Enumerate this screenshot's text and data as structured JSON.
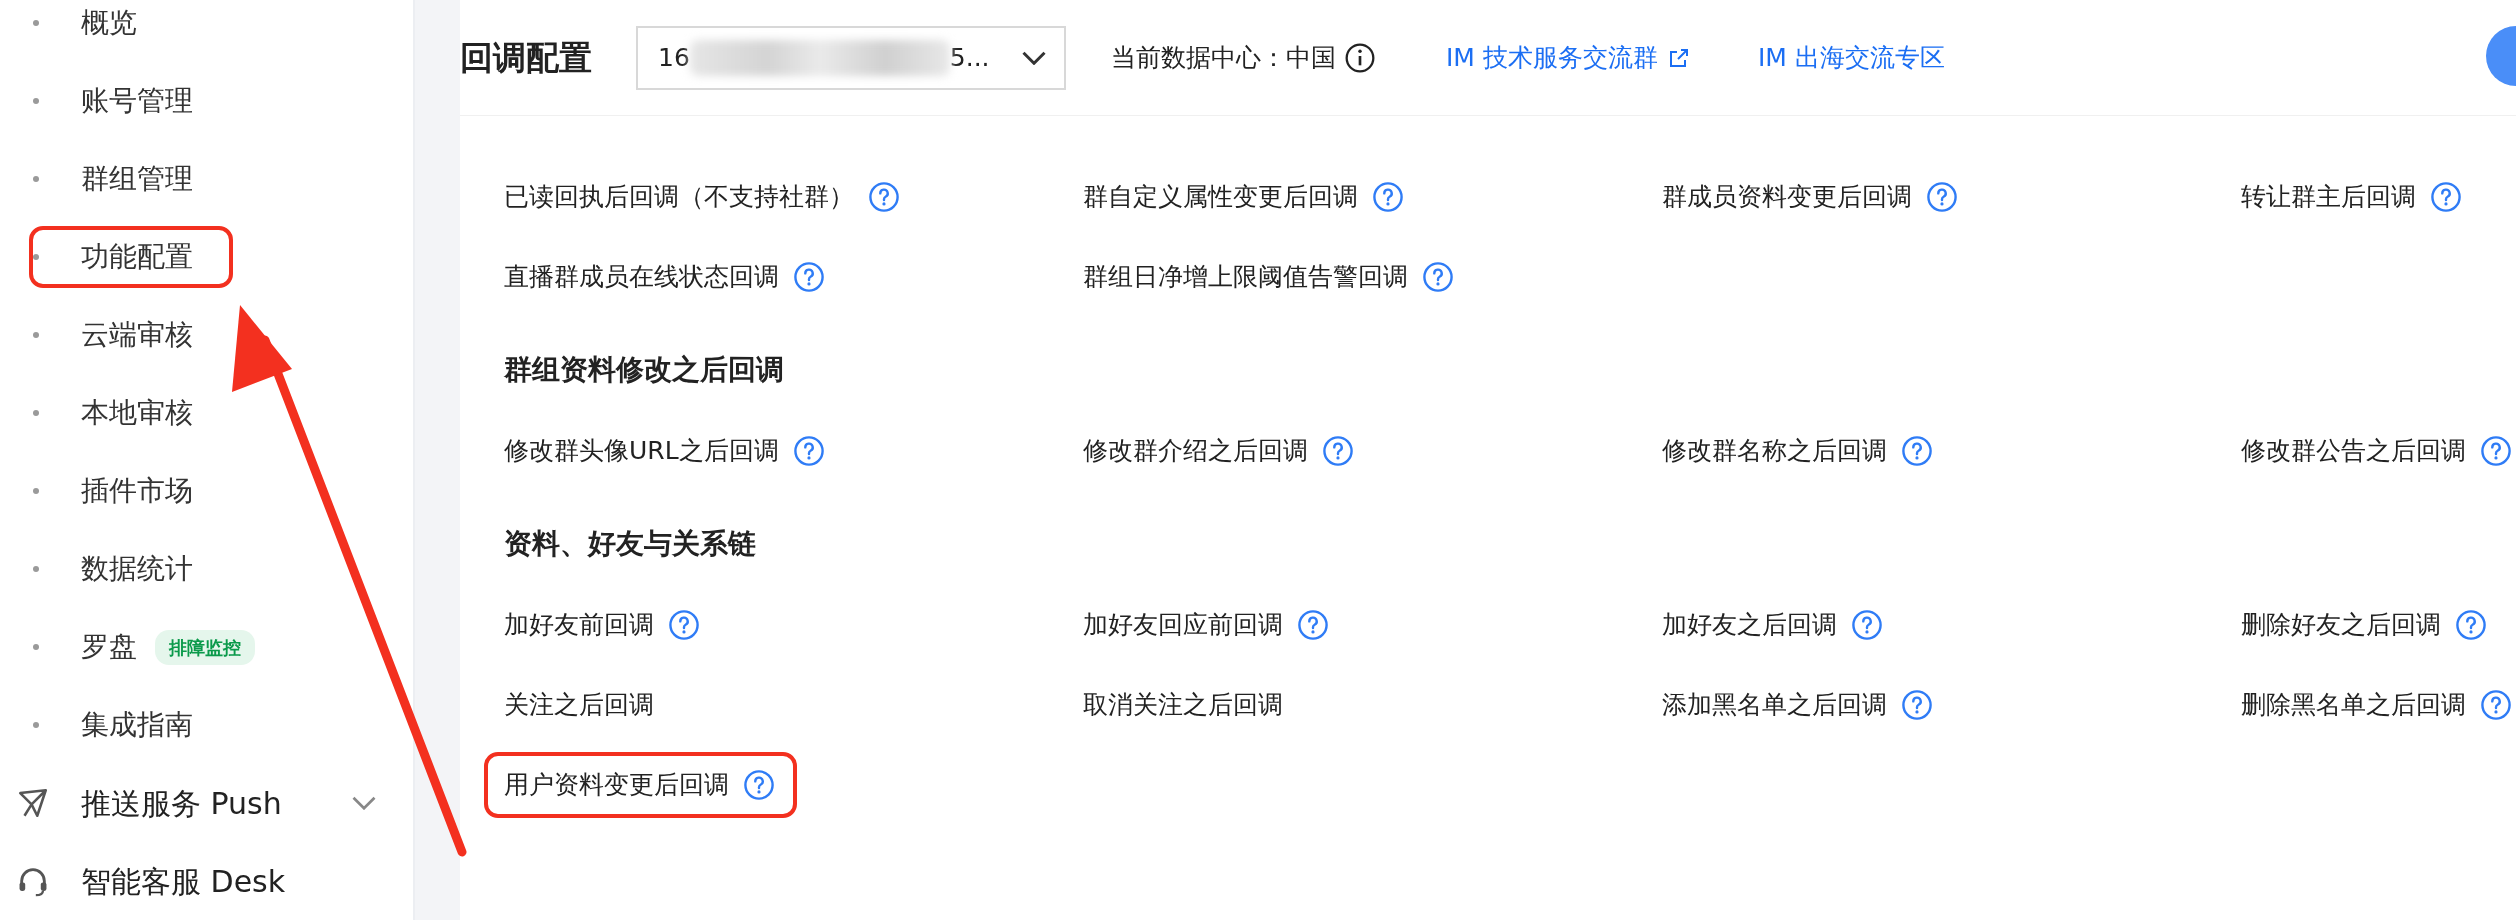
{
  "sidebar": {
    "items": [
      {
        "label": "概览",
        "kind": "sub",
        "highlighted": false
      },
      {
        "label": "账号管理",
        "kind": "sub",
        "highlighted": false
      },
      {
        "label": "群组管理",
        "kind": "sub",
        "highlighted": false
      },
      {
        "label": "功能配置",
        "kind": "sub",
        "highlighted": true
      },
      {
        "label": "云端审核",
        "kind": "sub",
        "highlighted": false
      },
      {
        "label": "本地审核",
        "kind": "sub",
        "highlighted": false
      },
      {
        "label": "插件市场",
        "kind": "sub",
        "highlighted": false
      },
      {
        "label": "数据统计",
        "kind": "sub",
        "highlighted": false
      },
      {
        "label": "罗盘",
        "kind": "sub",
        "highlighted": false,
        "badge": "排障监控"
      },
      {
        "label": "集成指南",
        "kind": "sub",
        "highlighted": false
      },
      {
        "label": "推送服务 Push",
        "kind": "push",
        "highlighted": false,
        "expandable": true
      },
      {
        "label": "智能客服 Desk",
        "kind": "desk",
        "highlighted": false
      }
    ]
  },
  "header": {
    "title": "回调配置",
    "app_select": {
      "value_start": "16",
      "value_end": "5..."
    },
    "data_center": "当前数据中心：中国",
    "links": [
      {
        "label": "IM 技术服务交流群",
        "external": true
      },
      {
        "label": "IM 出海交流专区",
        "external": false
      }
    ]
  },
  "sections": [
    {
      "rows": [
        [
          {
            "label": "已读回执后回调（不支持社群）",
            "help": true,
            "highlighted": false
          },
          {
            "label": "群自定义属性变更后回调",
            "help": true,
            "highlighted": false
          },
          {
            "label": "群成员资料变更后回调",
            "help": true,
            "highlighted": false
          },
          {
            "label": "转让群主后回调",
            "help": true,
            "highlighted": false
          }
        ],
        [
          {
            "label": "直播群成员在线状态回调",
            "help": true,
            "highlighted": false
          },
          {
            "label": "群组日净增上限阈值告警回调",
            "help": true,
            "highlighted": false
          }
        ]
      ]
    },
    {
      "title": "群组资料修改之后回调",
      "rows": [
        [
          {
            "label": "修改群头像URL之后回调",
            "help": true,
            "highlighted": false
          },
          {
            "label": "修改群介绍之后回调",
            "help": true,
            "highlighted": false
          },
          {
            "label": "修改群名称之后回调",
            "help": true,
            "highlighted": false
          },
          {
            "label": "修改群公告之后回调",
            "help": true,
            "highlighted": false
          }
        ]
      ]
    },
    {
      "title": "资料、好友与关系链",
      "rows": [
        [
          {
            "label": "加好友前回调",
            "help": true,
            "highlighted": false
          },
          {
            "label": "加好友回应前回调",
            "help": true,
            "highlighted": false
          },
          {
            "label": "加好友之后回调",
            "help": true,
            "highlighted": false
          },
          {
            "label": "删除好友之后回调",
            "help": true,
            "highlighted": false
          }
        ],
        [
          {
            "label": "关注之后回调",
            "help": false,
            "highlighted": false
          },
          {
            "label": "取消关注之后回调",
            "help": false,
            "highlighted": false
          },
          {
            "label": "添加黑名单之后回调",
            "help": true,
            "highlighted": false
          },
          {
            "label": "删除黑名单之后回调",
            "help": true,
            "highlighted": false
          }
        ],
        [
          {
            "label": "用户资料变更后回调",
            "help": true,
            "highlighted": true
          }
        ]
      ]
    }
  ]
}
